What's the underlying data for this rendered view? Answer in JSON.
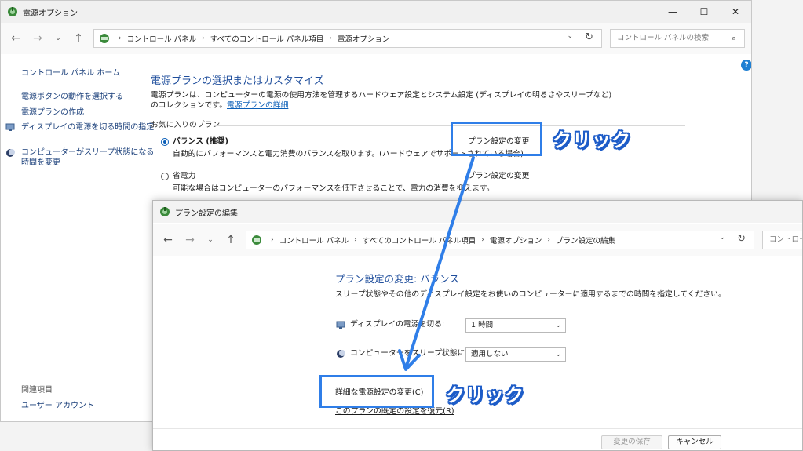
{
  "back_window": {
    "title": "電源オプション",
    "caption": {
      "minimize": "—",
      "maximize": "☐",
      "close": "✕"
    },
    "nav": {
      "back": "←",
      "forward": "→",
      "recent": "⌄",
      "up": "↑"
    },
    "breadcrumb": [
      "コントロール パネル",
      "すべてのコントロール パネル項目",
      "電源オプション"
    ],
    "search_placeholder": "コントロール パネルの検索",
    "help": "?",
    "sidebar": {
      "home": "コントロール パネル ホーム",
      "items": [
        "電源ボタンの動作を選択する",
        "電源プランの作成",
        "ディスプレイの電源を切る時間の指定",
        "コンピューターがスリープ状態になる",
        "時間を変更"
      ],
      "related_heading": "関連項目",
      "related_items": [
        "ユーザー アカウント"
      ]
    },
    "main": {
      "heading": "電源プランの選択またはカスタマイズ",
      "desc_line1": "電源プランは、コンピューターの電源の使用方法を管理するハードウェア設定とシステム設定 (ディスプレイの明るさやスリープなど)",
      "desc_line2_prefix": "のコレクションです。",
      "desc_link": "電源プランの詳細",
      "favorites_label": "お気に入りのプラン",
      "plans": [
        {
          "name": "バランス (推奨)",
          "desc": "自動的にパフォーマンスと電力消費のバランスを取ります。(ハードウェアでサポートされている場合)",
          "link": "プラン設定の変更",
          "selected": true
        },
        {
          "name": "省電力",
          "desc": "可能な場合はコンピューターのパフォーマンスを低下させることで、電力の消費を抑えます。",
          "link": "プラン設定の変更",
          "selected": false
        }
      ]
    }
  },
  "front_window": {
    "title": "プラン設定の編集",
    "nav": {
      "back": "←",
      "forward": "→",
      "recent": "⌄",
      "up": "↑"
    },
    "breadcrumb": [
      "コントロール パネル",
      "すべてのコントロール パネル項目",
      "電源オプション",
      "プラン設定の編集"
    ],
    "search_placeholder": "コントロール",
    "heading": "プラン設定の変更: バランス",
    "desc": "スリープ状態やその他のディスプレイ設定をお使いのコンピューターに適用するまでの時間を指定してください。",
    "rows": [
      {
        "label": "ディスプレイの電源を切る:",
        "value": "1 時間"
      },
      {
        "label": "コンピューターをスリープ状態にする:",
        "value": "適用しない"
      }
    ],
    "advanced_link": "詳細な電源設定の変更(C)",
    "restore_link": "このプランの既定の設定を復元(R)",
    "save_button": "変更の保存",
    "cancel_button": "キャンセル"
  },
  "annotations": {
    "click_label_1": "クリック",
    "click_label_2": "クリック",
    "accent_color": "#2f7ee8"
  }
}
